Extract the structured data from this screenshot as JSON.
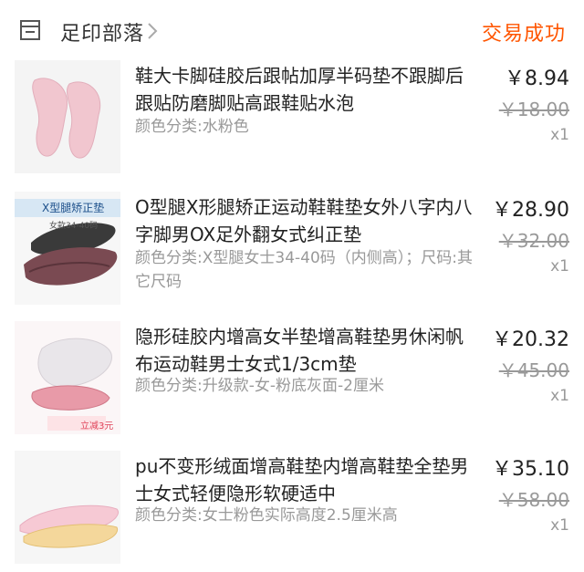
{
  "header": {
    "shop_name": "足印部落",
    "status": "交易成功",
    "status_color": "#ff5500",
    "shop_icon": "store-icon",
    "chevron_icon": "chevron-right-icon"
  },
  "items": [
    {
      "title": "鞋大卡脚硅胶后跟帖加厚半码垫不跟脚后跟贴防磨脚贴高跟鞋贴水泡",
      "spec": "颜色分类:水粉色",
      "price": "￥8.94",
      "original_price": "￥18.00",
      "quantity": "x1"
    },
    {
      "title": "O型腿X形腿矫正运动鞋鞋垫女外八字内八字脚男OX足外翻女式纠正垫",
      "spec": "颜色分类:X型腿女士34-40码（内侧高）；尺码:其它尺码",
      "price": "￥28.90",
      "original_price": "￥32.00",
      "quantity": "x1",
      "thumb_banner": "X型腿矫正垫",
      "thumb_sub": "女款34-40码"
    },
    {
      "title": "隐形硅胶内增高女半垫增高鞋垫男休闲帆布运动鞋男士女式1/3cm垫",
      "spec": "颜色分类:升级款-女-粉底灰面-2厘米",
      "price": "￥20.32",
      "original_price": "￥45.00",
      "quantity": "x1",
      "thumb_tag": "立减3元"
    },
    {
      "title": "pu不变形绒面增高鞋垫内增高鞋垫全垫男士女式轻便隐形软硬适中",
      "spec": "颜色分类:女士粉色实际高度2.5厘米高",
      "price": "￥35.10",
      "original_price": "￥58.00",
      "quantity": "x1"
    }
  ]
}
